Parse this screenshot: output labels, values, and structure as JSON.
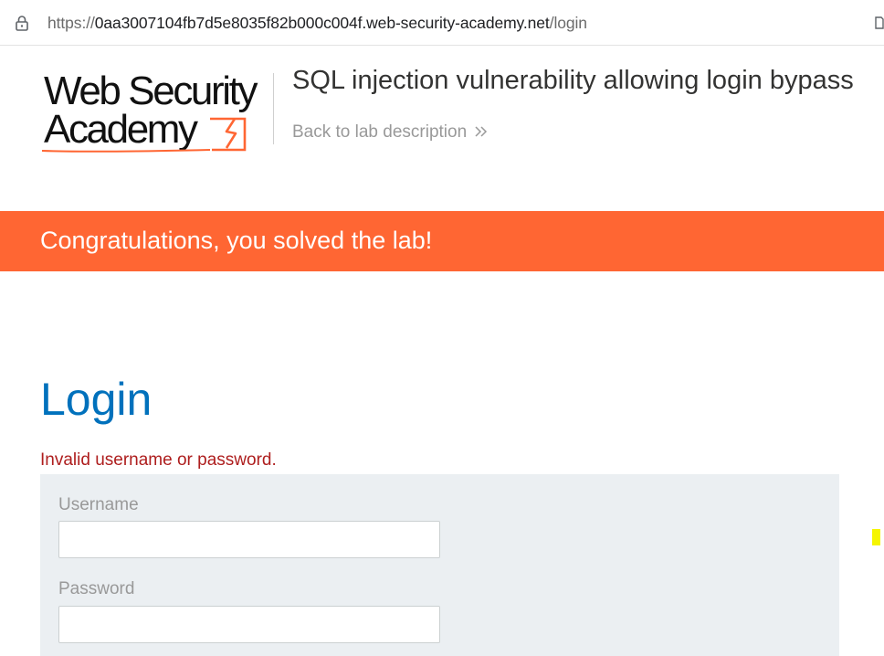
{
  "browser": {
    "url_scheme": "https://",
    "url_host": "0aa3007104fb7d5e8035f82b000c004f.web-security-academy.net",
    "url_path": "/login",
    "icons": [
      "lock-icon"
    ]
  },
  "header": {
    "logo_line1": "Web Security",
    "logo_line2": "Academy",
    "lab_title": "SQL injection vulnerability allowing login bypass",
    "back_link": "Back to lab description"
  },
  "banner": {
    "message": "Congratulations, you solved the lab!",
    "color": "#ff6633"
  },
  "login": {
    "heading": "Login",
    "error": "Invalid username or password.",
    "username_label": "Username",
    "username_value": "",
    "password_label": "Password",
    "password_value": ""
  },
  "colors": {
    "heading_blue": "#0071bc",
    "error_red": "#ae1e1e",
    "form_bg": "#ebeff2"
  }
}
